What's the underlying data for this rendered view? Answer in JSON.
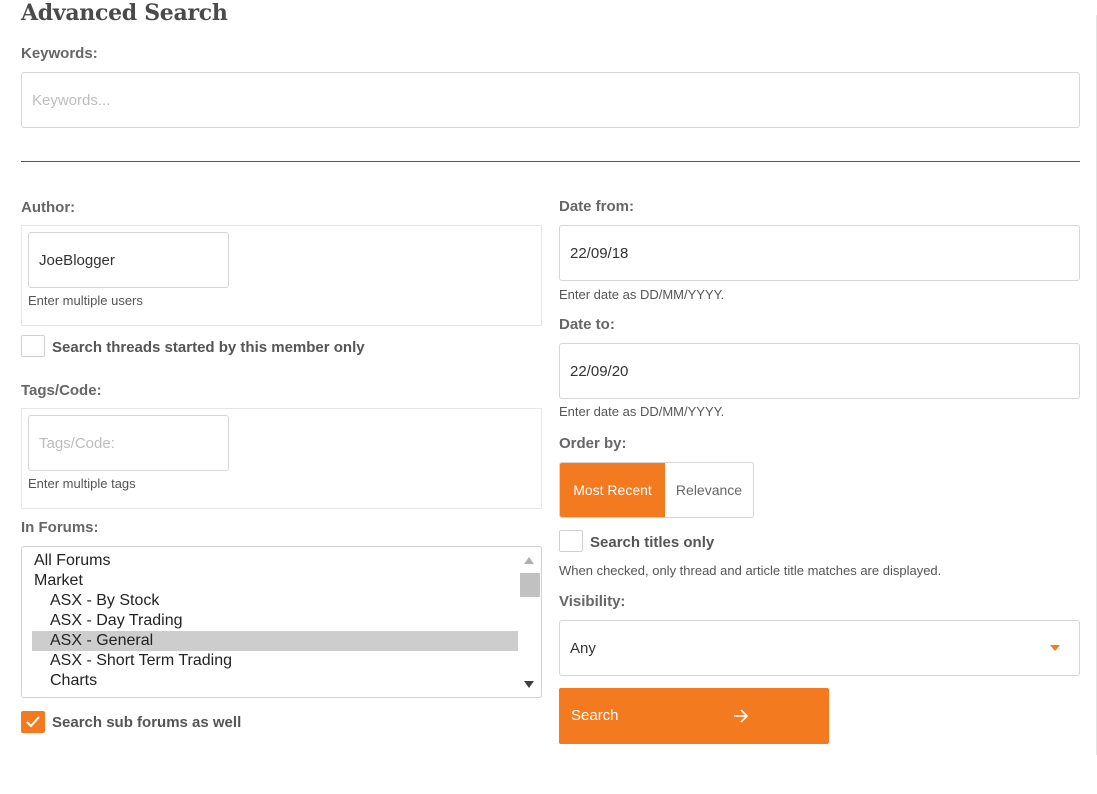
{
  "page": {
    "title": "Advanced Search"
  },
  "keywords": {
    "label": "Keywords:",
    "placeholder": "Keywords...",
    "value": ""
  },
  "author": {
    "label": "Author:",
    "value": "JoeBlogger",
    "hint": "Enter multiple users",
    "threads_checkbox_label": "Search threads started by this member only",
    "threads_checked": false
  },
  "tags": {
    "label": "Tags/Code:",
    "placeholder": "Tags/Code:",
    "hint": "Enter multiple tags"
  },
  "forums": {
    "label": "In Forums:",
    "items": [
      {
        "label": "All Forums",
        "indent": 0,
        "selected": false
      },
      {
        "label": "Market",
        "indent": 0,
        "selected": false
      },
      {
        "label": "ASX - By Stock",
        "indent": 1,
        "selected": false
      },
      {
        "label": "ASX - Day Trading",
        "indent": 1,
        "selected": false
      },
      {
        "label": "ASX - General",
        "indent": 1,
        "selected": true
      },
      {
        "label": "ASX - Short Term Trading",
        "indent": 1,
        "selected": false
      },
      {
        "label": "Charts",
        "indent": 1,
        "selected": false
      }
    ],
    "sub_forums_label": "Search sub forums as well",
    "sub_forums_checked": true
  },
  "date_from": {
    "label": "Date from:",
    "value": "22/09/18",
    "hint": "Enter date as DD/MM/YYYY."
  },
  "date_to": {
    "label": "Date to:",
    "value": "22/09/20",
    "hint": "Enter date as DD/MM/YYYY."
  },
  "order": {
    "label": "Order by:",
    "options": [
      "Most Recent",
      "Relevance"
    ],
    "selected": "Most Recent"
  },
  "titles_only": {
    "label": "Search titles only",
    "hint": "When checked, only thread and article title matches are displayed.",
    "checked": false
  },
  "visibility": {
    "label": "Visibility:",
    "value": "Any"
  },
  "search_button": {
    "label": "Search",
    "icon": "arrow-right-icon"
  },
  "colors": {
    "accent": "#f47a20",
    "selected_option": "#cdcdcd"
  }
}
